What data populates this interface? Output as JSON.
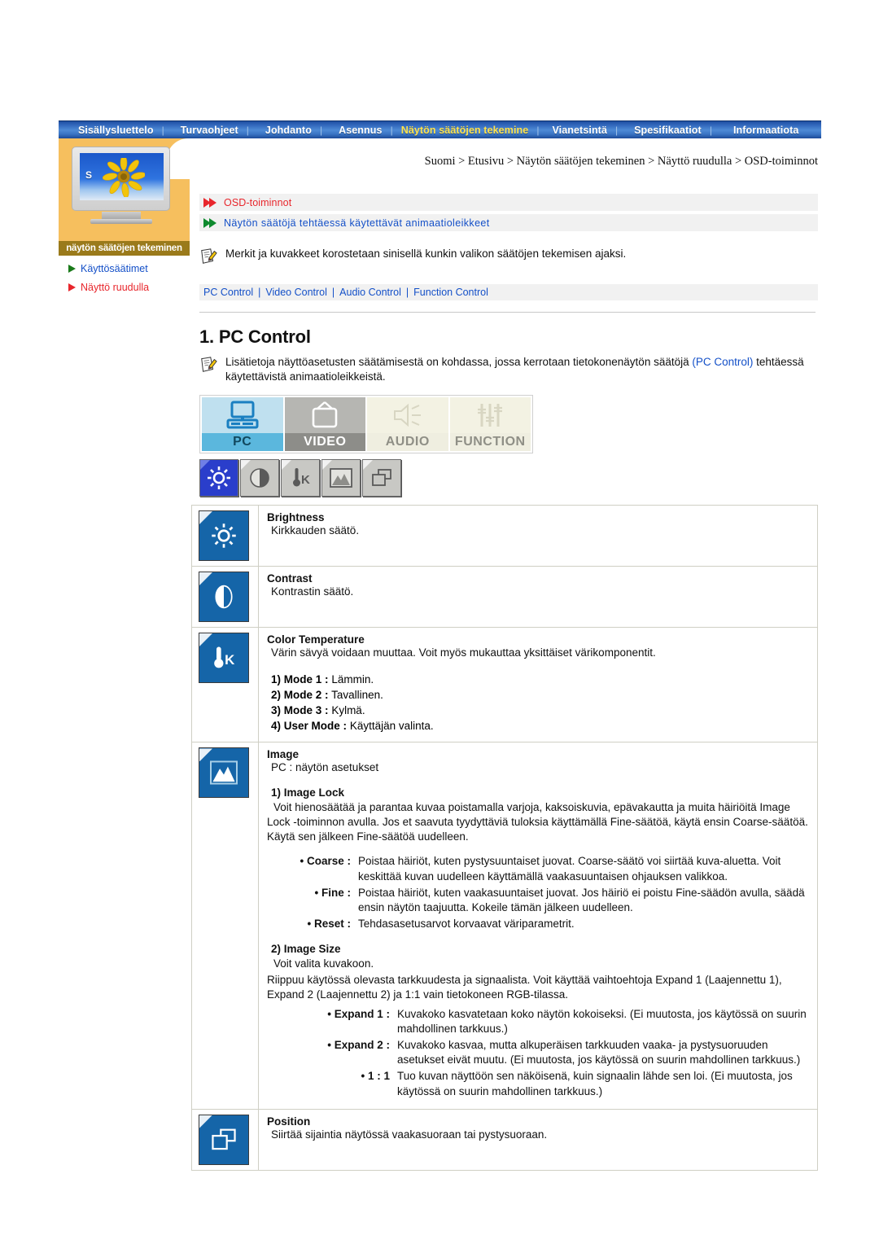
{
  "nav": {
    "items": [
      {
        "label": "Sisällysluettelo",
        "active": false
      },
      {
        "label": "Turvaohjeet",
        "active": false
      },
      {
        "label": "Johdanto",
        "active": false
      },
      {
        "label": "Asennus",
        "active": false
      },
      {
        "label": "Näytön säätöjen tekemine",
        "active": true
      },
      {
        "label": "Vianetsintä",
        "active": false
      },
      {
        "label": "Spesifikaatiot",
        "active": false
      },
      {
        "label": "Informaatiota",
        "active": false
      }
    ],
    "separator": "|"
  },
  "sidebar": {
    "screen_letters": "S",
    "caption": "näytön säätöjen tekeminen",
    "links": [
      {
        "label": "Käyttösäätimet",
        "current": false
      },
      {
        "label": "Näyttö ruudulla",
        "current": true
      }
    ]
  },
  "breadcrumb": "Suomi > Etusivu > Näytön säätöjen tekeminen > Näyttö ruudulla > OSD-toiminnot",
  "section_headers": [
    {
      "label": "OSD-toiminnot"
    },
    {
      "label": "Näytön säätöjä tehtäessä käytettävät animaatioleikkeet"
    }
  ],
  "note": "Merkit ja kuvakkeet korostetaan sinisellä kunkin valikon säätöjen tekemisen ajaksi.",
  "control_links": [
    "PC Control",
    "Video Control",
    "Audio Control",
    "Function Control"
  ],
  "control_links_separator": "|",
  "heading": "1. PC Control",
  "intro": {
    "part1": "Lisätietoja näyttöasetusten säätämisestä on kohdassa, jossa kerrotaan tietokonenäytön säätöjä ",
    "link": "(PC Control)",
    "part2": " tehtäessä käytettävistä animaatioleikkeistä."
  },
  "big_tabs": [
    {
      "label": "PC",
      "icon": "monitor-icon",
      "active": true
    },
    {
      "label": "VIDEO",
      "icon": "tv-icon",
      "active": false
    },
    {
      "label": "AUDIO",
      "icon": "speaker-icon",
      "active": false
    },
    {
      "label": "FUNCTION",
      "icon": "sliders-icon",
      "active": false
    }
  ],
  "small_icons": [
    {
      "name": "brightness-icon",
      "active": true
    },
    {
      "name": "contrast-icon",
      "active": false
    },
    {
      "name": "color-temperature-icon",
      "active": false
    },
    {
      "name": "image-icon",
      "active": false
    },
    {
      "name": "position-icon",
      "active": false
    }
  ],
  "rows": {
    "brightness": {
      "title": "Brightness",
      "desc": "Kirkkauden säätö."
    },
    "contrast": {
      "title": "Contrast",
      "desc": "Kontrastin säätö."
    },
    "color_temperature": {
      "title": "Color Temperature",
      "desc": "Värin sävyä voidaan muuttaa. Voit myös mukauttaa yksittäiset värikomponentit.",
      "modes": [
        {
          "num": "1)",
          "name": "Mode 1 :",
          "value": "Lämmin."
        },
        {
          "num": "2)",
          "name": "Mode 2 :",
          "value": "Tavallinen."
        },
        {
          "num": "3)",
          "name": "Mode 3 :",
          "value": "Kylmä."
        },
        {
          "num": "4)",
          "name": "User Mode :",
          "value": "Käyttäjän valinta."
        }
      ]
    },
    "image": {
      "title": "Image",
      "desc": "PC : näytön asetukset",
      "lock": {
        "heading": "1) Image Lock",
        "body": "Voit hienosäätää ja parantaa kuvaa poistamalla varjoja, kaksoiskuvia, epävakautta ja muita häiriöitä Image Lock -toiminnon avulla. Jos et saavuta tyydyttäviä tuloksia käyttämällä Fine-säätöä, käytä ensin Coarse-säätöä. Käytä sen jälkeen Fine-säätöä uudelleen.",
        "items": [
          {
            "term": "• Coarse :",
            "desc": "Poistaa häiriöt, kuten pystysuuntaiset juovat. Coarse-säätö voi siirtää kuva-aluetta. Voit keskittää kuvan uudelleen käyttämällä vaakasuuntaisen ohjauksen valikkoa."
          },
          {
            "term": "• Fine :",
            "desc": "Poistaa häiriöt, kuten vaakasuuntaiset juovat. Jos häiriö ei poistu Fine-säädön avulla, säädä ensin näytön taajuutta. Kokeile tämän jälkeen uudelleen."
          },
          {
            "term": "• Reset :",
            "desc": "Tehdasasetusarvot korvaavat väriparametrit."
          }
        ]
      },
      "size": {
        "heading": "2) Image Size",
        "body1": "Voit valita kuvakoon.",
        "body2": "Riippuu käytössä olevasta tarkkuudesta ja signaalista. Voit käyttää vaihtoehtoja Expand 1 (Laajennettu 1), Expand 2 (Laajennettu 2) ja 1:1 vain tietokoneen RGB-tilassa.",
        "items": [
          {
            "term": "• Expand 1 :",
            "desc": "Kuvakoko kasvatetaan koko näytön kokoiseksi. (Ei muutosta, jos käytössä on suurin mahdollinen tarkkuus.)"
          },
          {
            "term": "• Expand 2 :",
            "desc": "Kuvakoko kasvaa, mutta alkuperäisen tarkkuuden vaaka- ja pystysuoruuden asetukset eivät muutu. (Ei muutosta, jos käytössä on suurin mahdollinen tarkkuus.)"
          },
          {
            "term": "• 1 : 1",
            "desc": "Tuo kuvan näyttöön sen näköisenä, kuin signaalin lähde sen loi. (Ei muutosta, jos käytössä on suurin mahdollinen tarkkuus.)"
          }
        ]
      }
    },
    "position": {
      "title": "Position",
      "desc": "Siirtää sijaintia näytössä vaakasuoraan tai pystysuoraan."
    }
  },
  "colors": {
    "nav_blue": "#2e63b8",
    "nav_active_text": "#ffe34d",
    "sidebar_orange": "#f6bf5e",
    "caption_brown": "#9a7a1b",
    "link_blue": "#1450c8",
    "red": "#e8262c",
    "green": "#0e8a2e",
    "icon_blue": "#1565a8",
    "active_small_icon": "#2a3ecb"
  }
}
